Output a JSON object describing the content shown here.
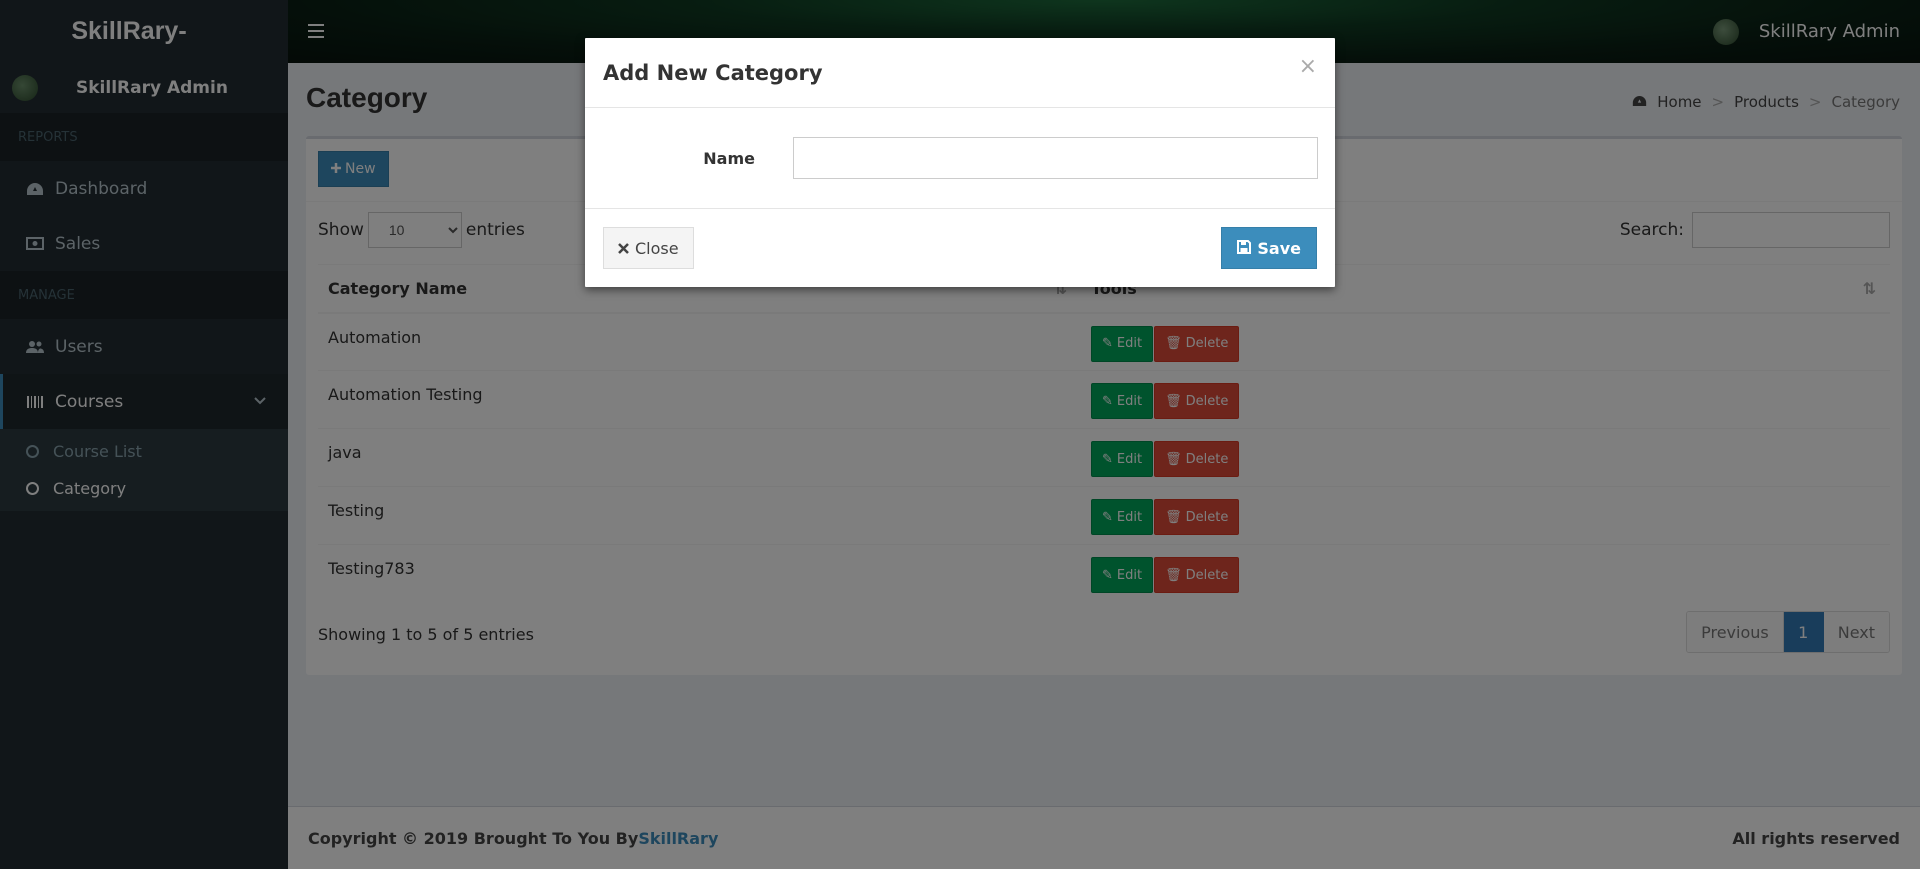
{
  "sidebar": {
    "logo": "SkillRary-",
    "user_name": "SkillRary Admin",
    "sections": {
      "reports": "REPORTS",
      "manage": "MANAGE"
    },
    "items": {
      "dashboard": "Dashboard",
      "sales": "Sales",
      "users": "Users",
      "courses": "Courses"
    },
    "submenu": {
      "course_list": "Course List",
      "category": "Category"
    }
  },
  "navbar": {
    "user_name": "SkillRary Admin"
  },
  "content": {
    "title": "Category",
    "breadcrumb": {
      "home": "Home",
      "products": "Products",
      "current": "Category"
    },
    "new_button": "New",
    "show_label": "Show",
    "entries_label": "entries",
    "page_size": "10",
    "search_label": "Search:",
    "columns": {
      "name": "Category Name",
      "tools": "Tools"
    },
    "rows": [
      {
        "name": "Automation"
      },
      {
        "name": "Automation Testing"
      },
      {
        "name": "java"
      },
      {
        "name": "Testing"
      },
      {
        "name": "Testing783"
      }
    ],
    "edit_label": "Edit",
    "delete_label": "Delete",
    "info": "Showing 1 to 5 of 5 entries",
    "pager": {
      "previous": "Previous",
      "current": "1",
      "next": "Next"
    }
  },
  "footer": {
    "copyright": "Copyright © 2019 Brought To You By",
    "brand": "SkillRary",
    "rights": "All rights reserved"
  },
  "modal": {
    "title": "Add New Category",
    "close_x": "×",
    "name_label": "Name",
    "name_value": "",
    "close_button": "Close",
    "save_button": "Save"
  },
  "colors": {
    "primary": "#3c8dbc",
    "success": "#00a65a",
    "danger": "#dd4b39",
    "sidebar": "#222d32"
  }
}
